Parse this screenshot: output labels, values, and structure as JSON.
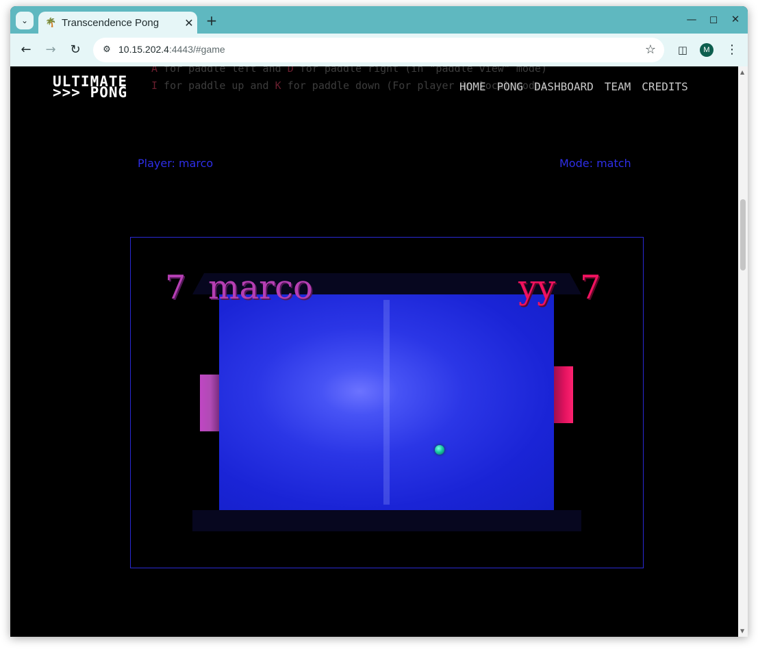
{
  "browser": {
    "tab_title": "Transcendence Pong",
    "url_host": "10.15.202.4",
    "url_rest": ":4443/#game",
    "profile_initial": "M"
  },
  "instructions": {
    "line1_key1": "A",
    "line1_text1": " for paddle left and ",
    "line1_key2": "D",
    "line1_text2": " for paddle right (in \"paddle view\" mode)",
    "line2_key1": "I",
    "line2_text1": " for paddle up and ",
    "line2_key2": "K",
    "line2_text2": " for paddle down (For player in local mode)"
  },
  "logo": {
    "line1": "ULTIMATE",
    "line2": ">>> PONG"
  },
  "nav": {
    "items": [
      "HOME",
      "PONG",
      "DASHBOARD",
      "TEAM",
      "CREDITS"
    ]
  },
  "game": {
    "player_label": "Player: marco",
    "mode_label": "Mode: match",
    "left_score": "7",
    "left_name": "marco",
    "right_name": "yy",
    "right_score": "7"
  }
}
